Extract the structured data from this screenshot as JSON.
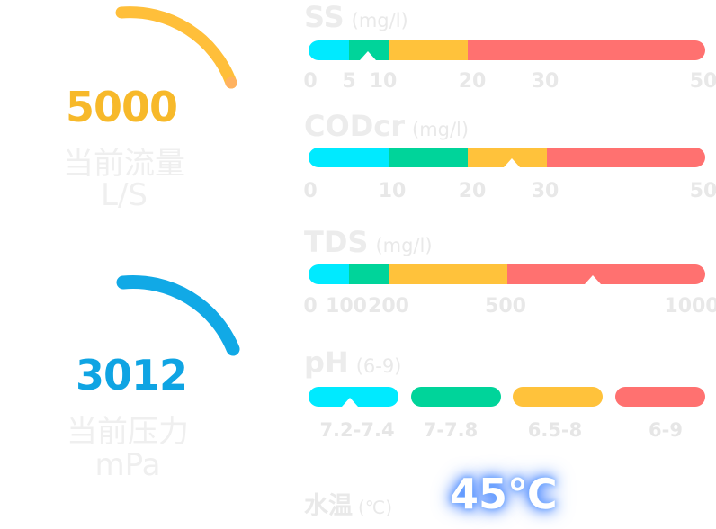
{
  "colors": {
    "cyan": "#00eaff",
    "green": "#00d49a",
    "yellow": "#ffc23b",
    "red": "#ff7170",
    "flow_gauge": "#ffbf3a",
    "pressure_gauge": "#11a9e6",
    "flow_value": "#f7b92a",
    "pressure_value": "#0fa4e3"
  },
  "flow": {
    "value": "5000",
    "label": "当前流量",
    "unit": "L/S"
  },
  "pressure": {
    "value": "3012",
    "label": "当前压力",
    "unit": "mPa"
  },
  "ss": {
    "title": "SS",
    "unit": "(mg/l)",
    "ticks": [
      "0",
      "5",
      "10",
      "20",
      "30",
      "50"
    ],
    "marker_value": 7.5
  },
  "codcr": {
    "title": "CODcr",
    "unit": "(mg/l)",
    "ticks": [
      "0",
      "10",
      "20",
      "30",
      "50"
    ],
    "marker_value": 25
  },
  "tds": {
    "title": "TDS",
    "unit": "(mg/l)",
    "ticks": [
      "0",
      "100",
      "200",
      "500",
      "1000"
    ],
    "marker_value": 730
  },
  "ph": {
    "title": "pH",
    "unit": "(6-9)",
    "ranges": [
      "7.2-7.4",
      "7-7.8",
      "6.5-8",
      "6-9"
    ]
  },
  "water_temp": {
    "label": "水温",
    "unit": "(℃)",
    "value": "45℃"
  }
}
